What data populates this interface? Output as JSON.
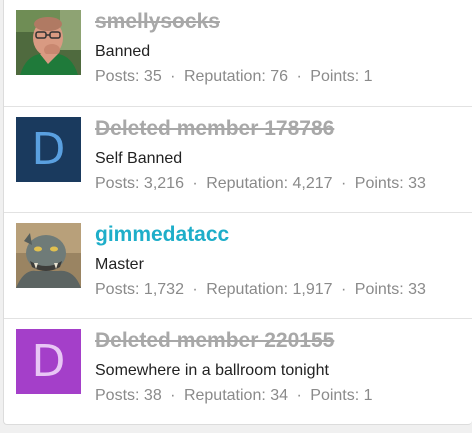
{
  "labels": {
    "posts": "Posts:",
    "reputation": "Reputation:",
    "points": "Points:",
    "separator": "·"
  },
  "members": [
    {
      "username": "smellysocks",
      "status": "deleted",
      "title": "Banned",
      "avatar": {
        "type": "photo",
        "subject": "man-with-glasses-green-shirt"
      },
      "posts": "35",
      "reputation": "76",
      "points": "1"
    },
    {
      "username": "Deleted member 178786",
      "status": "deleted",
      "title": "Self Banned",
      "avatar": {
        "type": "letter",
        "letter": "D",
        "bg": "#1a3a5e",
        "fg": "#5aa0e0"
      },
      "posts": "3,216",
      "reputation": "4,217",
      "points": "33"
    },
    {
      "username": "gimmedatacc",
      "status": "active",
      "title": "Master",
      "avatar": {
        "type": "photo",
        "subject": "orc-creature"
      },
      "posts": "1,732",
      "reputation": "1,917",
      "points": "33"
    },
    {
      "username": "Deleted member 220155",
      "status": "deleted",
      "title": "Somewhere in a ballroom tonight",
      "avatar": {
        "type": "letter",
        "letter": "D",
        "bg": "#a43fc9",
        "fg": "#e8c6f5"
      },
      "posts": "38",
      "reputation": "34",
      "points": "1"
    }
  ],
  "colors": {
    "active_username": "#1eaec9",
    "deleted_username": "#a8a8a8",
    "stats_text": "#8a8a8a"
  }
}
